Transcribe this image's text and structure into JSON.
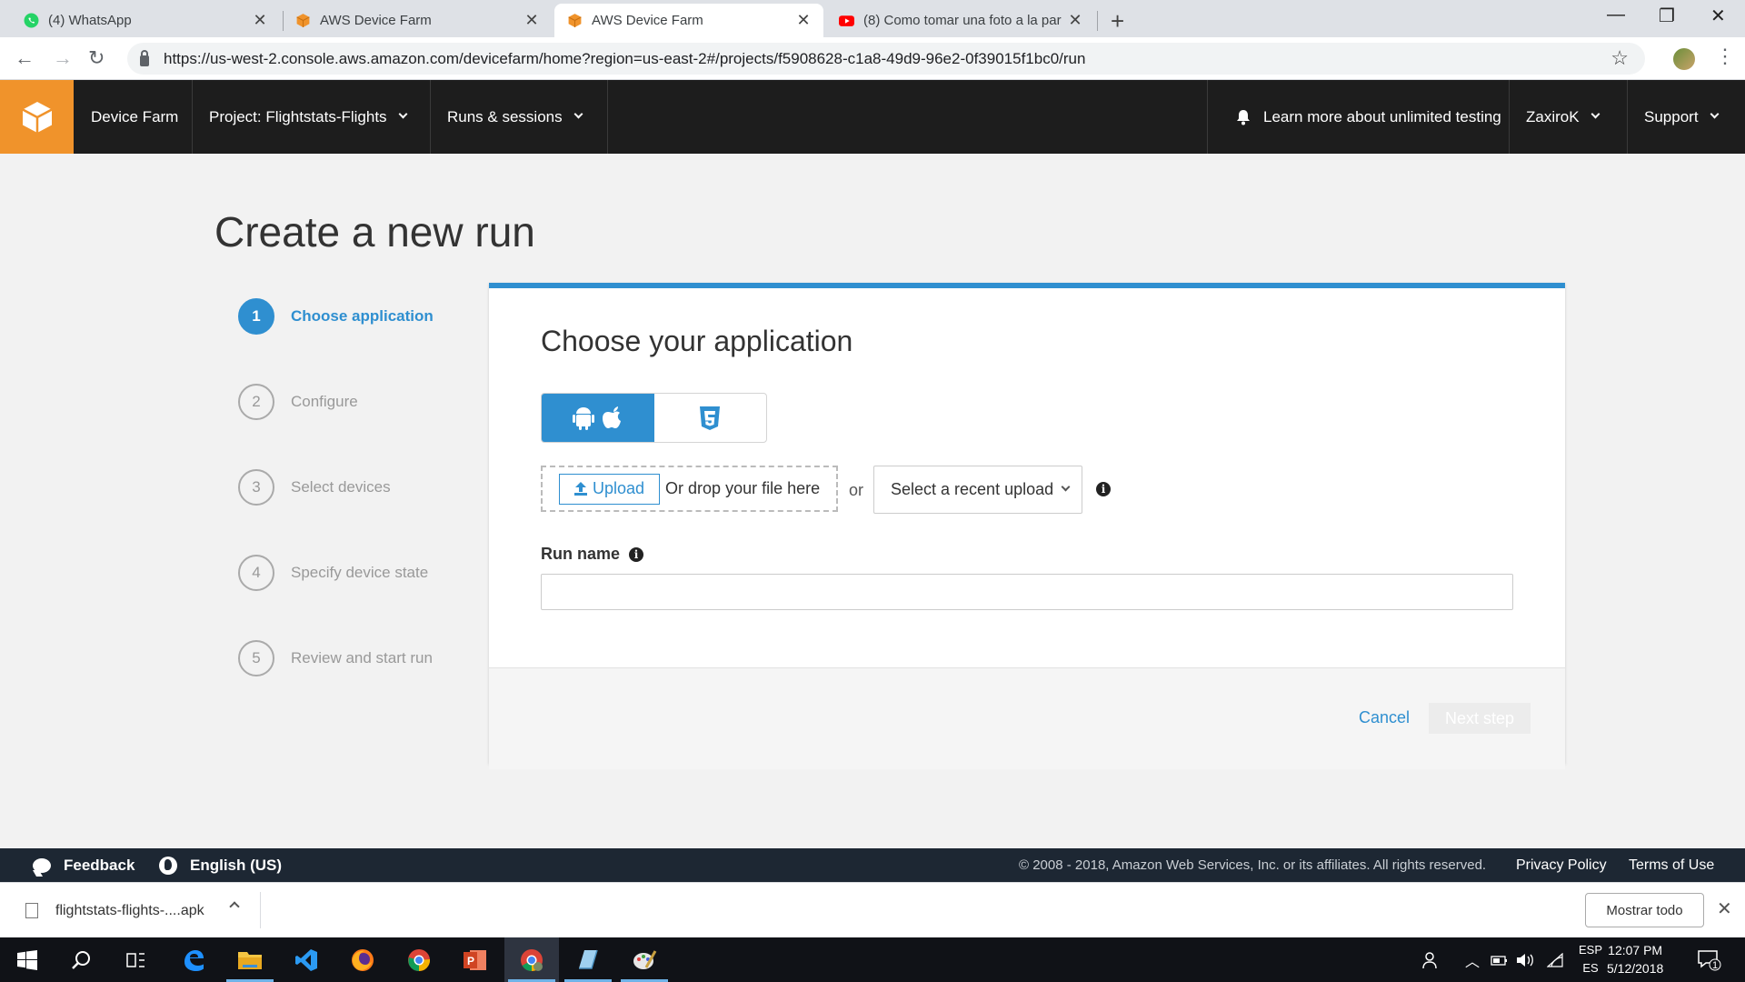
{
  "browser": {
    "tabs": [
      {
        "title": "(4) WhatsApp",
        "favicon": "whatsapp-icon",
        "active": false
      },
      {
        "title": "AWS Device Farm",
        "favicon": "aws-cube-icon",
        "active": false
      },
      {
        "title": "AWS Device Farm",
        "favicon": "aws-cube-icon",
        "active": true
      },
      {
        "title": "(8) Como tomar una foto a la par",
        "favicon": "youtube-icon",
        "active": false
      }
    ],
    "url": "https://us-west-2.console.aws.amazon.com/devicefarm/home?region=us-east-2#/projects/f5908628-c1a8-49d9-96e2-0f39015f1bc0/run"
  },
  "aws_nav": {
    "service": "Device Farm",
    "project": "Project: Flightstats-Flights",
    "runs": "Runs & sessions",
    "learn_more": "Learn more about unlimited testing",
    "user": "ZaxiroK",
    "support": "Support"
  },
  "page": {
    "title": "Create a new run",
    "steps": [
      {
        "num": "1",
        "label": "Choose application",
        "active": true
      },
      {
        "num": "2",
        "label": "Configure",
        "active": false
      },
      {
        "num": "3",
        "label": "Select devices",
        "active": false
      },
      {
        "num": "4",
        "label": "Specify device state",
        "active": false
      },
      {
        "num": "5",
        "label": "Review and start run",
        "active": false
      }
    ]
  },
  "card": {
    "title": "Choose your application",
    "platforms": [
      "android-apple-icon",
      "html5-icon"
    ],
    "upload_label": "Upload",
    "drop_text": "Or drop your file here",
    "or_text": "or",
    "recent_upload": "Select a recent upload",
    "run_name_label": "Run name",
    "run_name_value": "",
    "cancel_label": "Cancel",
    "next_label": "Next step"
  },
  "footer": {
    "feedback": "Feedback",
    "language": "English (US)",
    "copyright": "© 2008 - 2018, Amazon Web Services, Inc. or its affiliates. All rights reserved.",
    "privacy": "Privacy Policy",
    "terms": "Terms of Use"
  },
  "downloads": {
    "file": "flightstats-flights-....apk",
    "show_all": "Mostrar todo"
  },
  "taskbar": {
    "lang_top": "ESP",
    "lang_bottom": "ES",
    "time": "12:07 PM",
    "date": "5/12/2018",
    "notifications": "1"
  },
  "colors": {
    "aws_orange": "#f0932b",
    "accent_blue": "#2f8fd0",
    "nav_dark": "#1d1d1d",
    "footer_dark": "#1d2733"
  }
}
